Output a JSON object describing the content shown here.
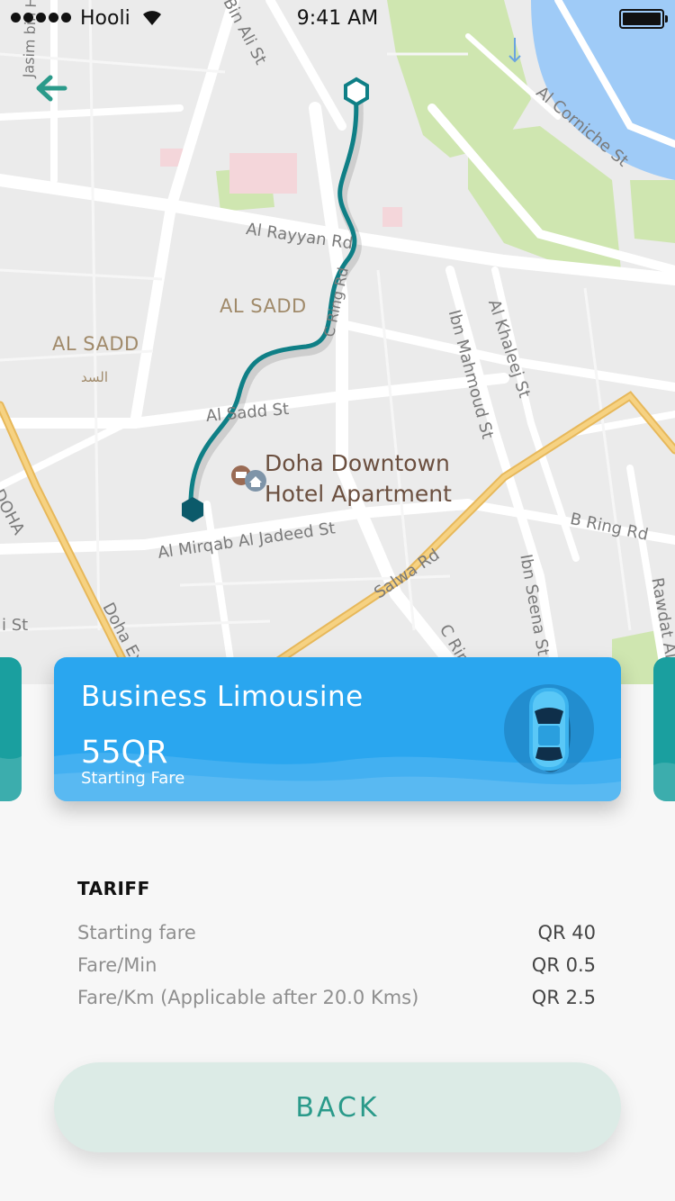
{
  "status_bar": {
    "carrier": "Hooli",
    "time": "9:41 AM"
  },
  "map": {
    "streets": {
      "jasim_hamad": "Jasim bin Hamad St",
      "bin_ali": "Bin Ali St",
      "corniche": "Al Corniche St",
      "rayyan": "Al Rayyan Rd",
      "c_ring_north": "C Ring Rd",
      "ibn_mahmoud": "Ibn Mahmoud St",
      "khaleej": "Al Khaleej St",
      "sadd_st": "Al Sadd St",
      "mirqab": "Al Mirqab Al Jadeed St",
      "salwa": "Salwa Rd",
      "b_ring": "B Ring Rd",
      "ibn_seena": "Ibn Seena St",
      "c_ring_south": "C Ring",
      "rawdat": "Rawdat Al",
      "doha_exp": "Doha Ex",
      "doha_left": "DOHA",
      "st_left": "i St"
    },
    "districts": {
      "one": "AL SADD",
      "two": "AL SADD"
    },
    "arabic_label": "السد",
    "poi": {
      "line1": "Doha Downtown",
      "line2": "Hotel Apartment"
    }
  },
  "card": {
    "title": "Business Limousine",
    "fare": "55QR",
    "fare_caption": "Starting Fare",
    "color": "#2aa6ef"
  },
  "tariff": {
    "heading": "TARIFF",
    "rows": [
      {
        "label": "Starting fare",
        "value": "QR 40"
      },
      {
        "label": "Fare/Min",
        "value": "QR 0.5"
      },
      {
        "label": "Fare/Km (Applicable after 20.0 Kms)",
        "value": "QR 2.5"
      }
    ]
  },
  "back_button": {
    "label": "BACK"
  },
  "icons": {
    "back": "arrow-left-icon",
    "start": "hexagon-origin-icon",
    "end": "destination-pin-icon",
    "hotel": "hotel-icon",
    "home": "home-icon",
    "car": "car-icon"
  },
  "colors": {
    "route": "#0f7f86",
    "accent": "#2a9a8a",
    "highway": "#f3c56b"
  }
}
